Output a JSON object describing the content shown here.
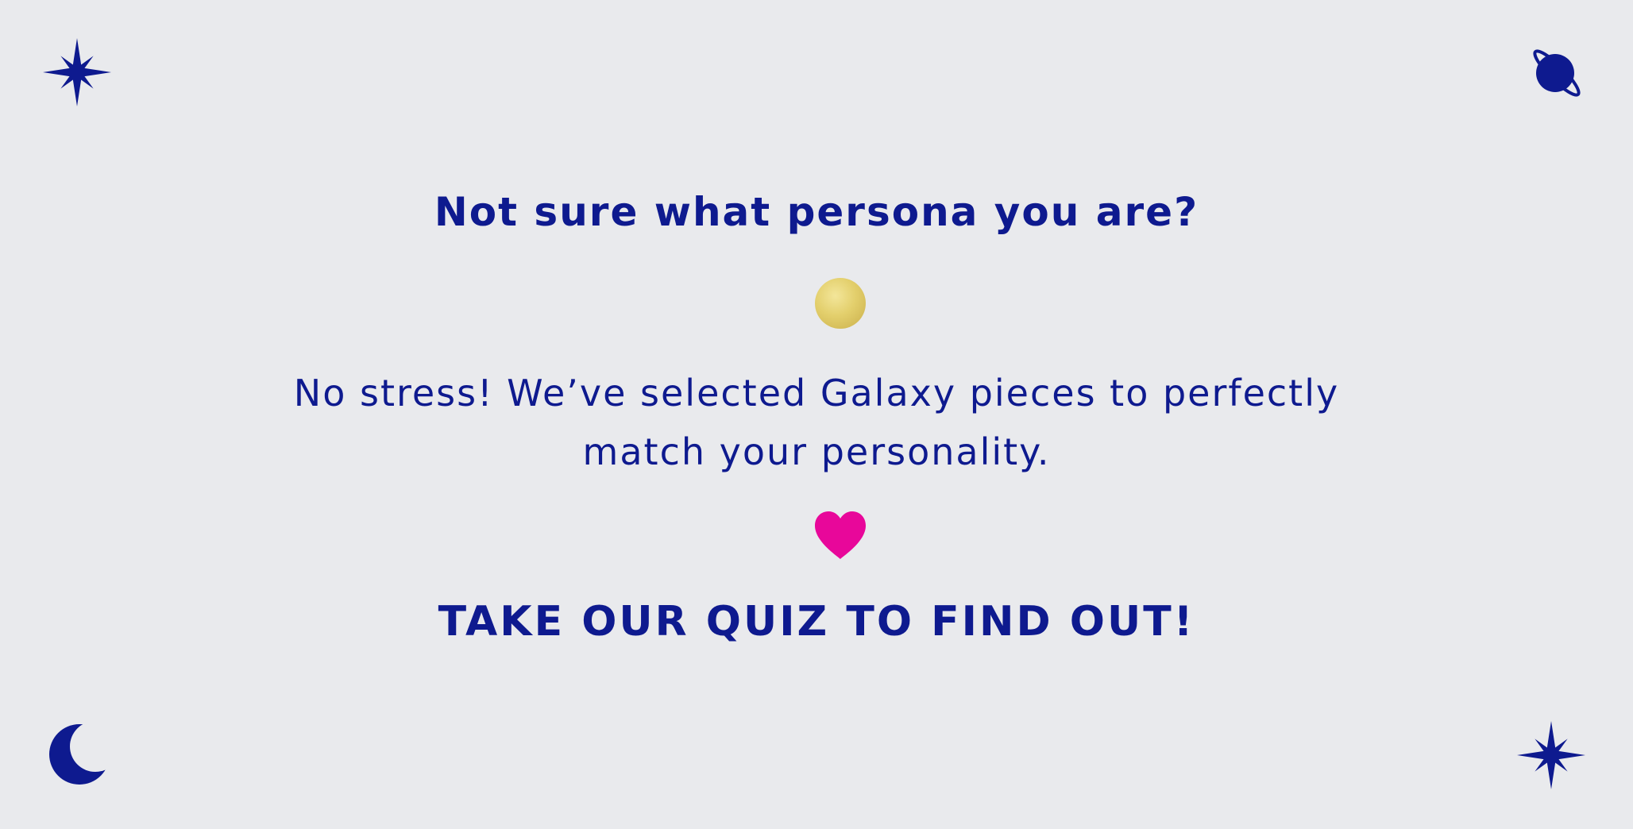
{
  "banner": {
    "heading": "Not sure what persona you are?",
    "body": "No stress! We’ve selected Galaxy pieces to perfectly match your personality.",
    "cta": "TAKE OUR QUIZ TO FIND OUT!"
  },
  "icons": {
    "top_left": "star-icon",
    "top_right": "planet-icon",
    "bottom_left": "crescent-moon-icon",
    "bottom_right": "star-icon",
    "center_top": "gold-circle-icon",
    "center_bottom": "heart-icon"
  },
  "colors": {
    "background": "#e9eaed",
    "primary": "#0e1a8f",
    "accent_heart": "#e8079a",
    "accent_gold": "#e3cf6c"
  }
}
